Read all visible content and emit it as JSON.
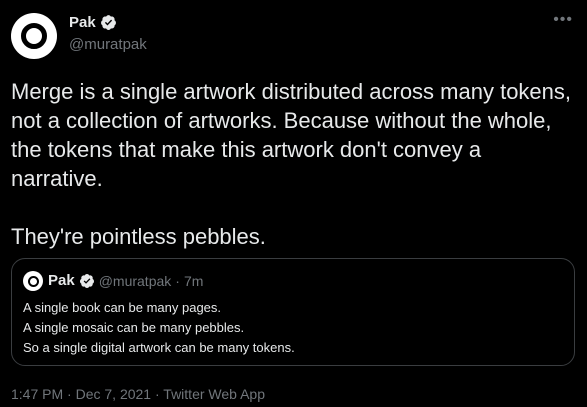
{
  "author": {
    "display_name": "Pak",
    "handle": "@muratpak",
    "avatar_icon": "pak-logo-icon",
    "verified_icon": "verified-badge-icon"
  },
  "more_menu_icon": "more-options-icon",
  "tweet": {
    "paragraphs": [
      "Merge is a single artwork distributed across many tokens, not a collection of artworks. Because without the whole, the tokens that make this artwork don't convey a narrative.",
      "They're pointless pebbles."
    ]
  },
  "quoted_tweet": {
    "display_name": "Pak",
    "handle": "@muratpak",
    "separator": "·",
    "time": "7m",
    "lines": [
      "A single book can be many pages.",
      "A single mosaic can be many pebbles.",
      "So a single digital artwork can be many tokens."
    ]
  },
  "meta": {
    "time": "1:47 PM",
    "separator": "·",
    "date": "Dec 7, 2021",
    "source": "Twitter Web App"
  },
  "colors": {
    "background": "#000000",
    "text": "#e7e9ea",
    "secondary_text": "#71767b",
    "verified": "#1d9bf0",
    "quote_border": "#3a3d40"
  }
}
